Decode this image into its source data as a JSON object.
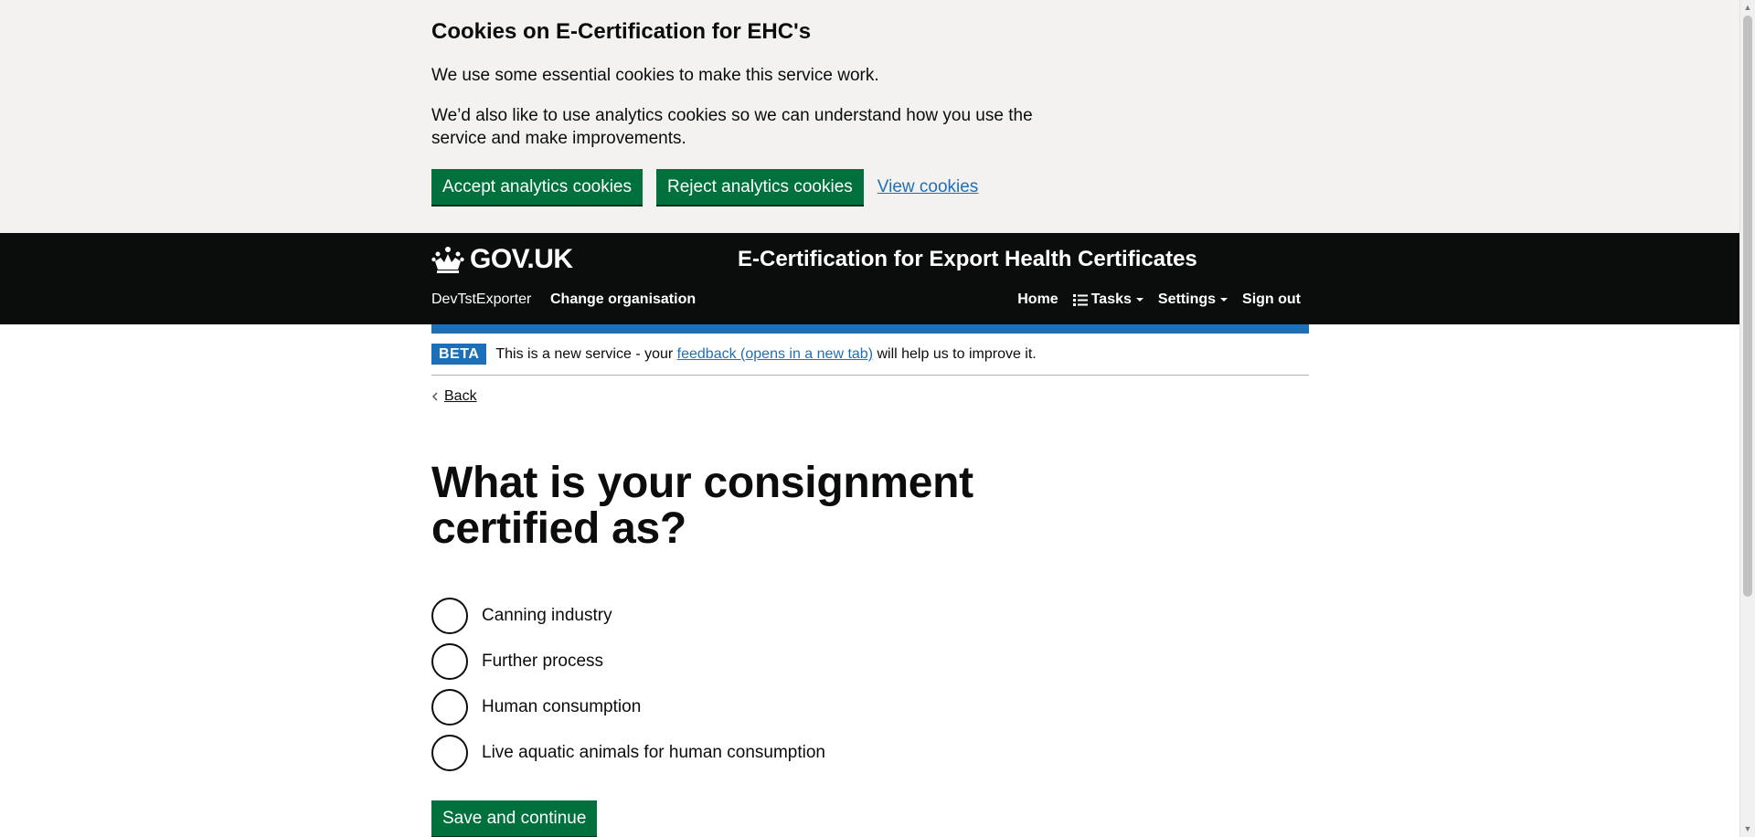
{
  "cookie_banner": {
    "title": "Cookies on E-Certification for EHC's",
    "paragraph1": "We use some essential cookies to make this service work.",
    "paragraph2": "We’d also like to use analytics cookies so we can understand how you use the service and make improvements.",
    "accept_label": "Accept analytics cookies",
    "reject_label": "Reject analytics cookies",
    "view_label": "View cookies"
  },
  "header": {
    "logo_text": "GOV.UK",
    "service_name": "E-Certification for Export Health Certificates",
    "organisation": "DevTstExporter",
    "change_org_label": "Change organisation",
    "nav": {
      "home": "Home",
      "tasks": "Tasks",
      "settings": "Settings",
      "sign_out": "Sign out"
    }
  },
  "phase_banner": {
    "tag": "BETA",
    "text_before": "This is a new service - your ",
    "link_text": "feedback (opens in a new tab)",
    "text_after": " will help us to improve it."
  },
  "back_label": "Back",
  "question": {
    "heading": "What is your consignment certified as?",
    "options": [
      "Canning industry",
      "Further process",
      "Human consumption",
      "Live aquatic animals for human consumption"
    ]
  },
  "save_label": "Save and continue",
  "colors": {
    "header_bg": "#0b0c0c",
    "button_green": "#00703c",
    "link_blue": "#1d70b8",
    "banner_bg": "#f3f2f1"
  }
}
